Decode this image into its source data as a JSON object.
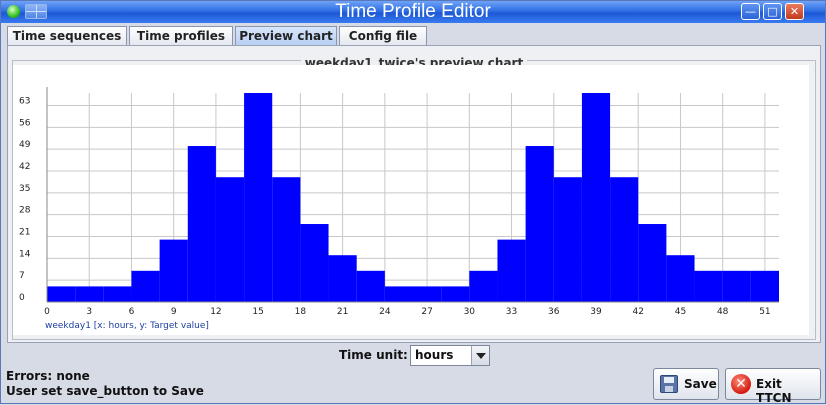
{
  "window": {
    "title": "Time Profile Editor",
    "minimize_glyph": "—",
    "maximize_glyph": "□",
    "close_glyph": "✕"
  },
  "tabs": [
    {
      "label": "Time sequences",
      "active": false
    },
    {
      "label": "Time profiles",
      "active": false
    },
    {
      "label": "Preview chart",
      "active": true
    },
    {
      "label": "Config file",
      "active": false
    }
  ],
  "preview": {
    "group_title": "weekday1_twice's preview chart"
  },
  "chart_data": {
    "type": "bar",
    "series": [
      {
        "name": "weekday1",
        "values": [
          5,
          5,
          5,
          10,
          20,
          50,
          40,
          67,
          40,
          25,
          15,
          10,
          5,
          5,
          5,
          10,
          20,
          50,
          40,
          67,
          40,
          25,
          15,
          10,
          10,
          10
        ]
      }
    ],
    "x_bin_width": 2,
    "x_start": 0,
    "x_ticks": [
      0,
      3,
      6,
      9,
      12,
      15,
      18,
      21,
      24,
      27,
      30,
      33,
      36,
      39,
      42,
      45,
      48,
      51
    ],
    "y_ticks": [
      0,
      7,
      14,
      21,
      28,
      35,
      42,
      49,
      56,
      63
    ],
    "xlim": [
      0,
      52
    ],
    "ylim": [
      0,
      67
    ],
    "legend_text": "weekday1 [x: hours, y: Target value]",
    "bar_color": "#0000ff",
    "grid": true
  },
  "controls": {
    "time_unit_label": "Time unit:",
    "time_unit_value": "hours"
  },
  "status": {
    "errors": "Errors: none",
    "message": "User set save_button to Save"
  },
  "buttons": {
    "save_label": "Save",
    "exit_label": "Exit TTCN"
  }
}
